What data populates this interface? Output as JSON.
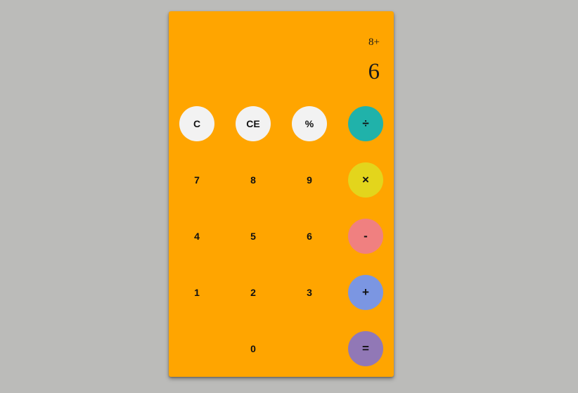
{
  "display": {
    "expression": "8+",
    "result": "6"
  },
  "keys": {
    "clear": "C",
    "clear_entry": "CE",
    "percent": "%",
    "divide": "÷",
    "seven": "7",
    "eight": "8",
    "nine": "9",
    "multiply": "×",
    "four": "4",
    "five": "5",
    "six": "6",
    "subtract": "-",
    "one": "1",
    "two": "2",
    "three": "3",
    "add": "+",
    "zero": "0",
    "equals": "="
  },
  "colors": {
    "background": "#bbbbb9",
    "calculator_body": "#ffa500",
    "function_key": "#f2f2f2",
    "divide_key": "#20b2aa",
    "multiply_key": "#e3d51c",
    "subtract_key": "#f08080",
    "add_key": "#7b96e2",
    "equals_key": "#9178b6"
  }
}
